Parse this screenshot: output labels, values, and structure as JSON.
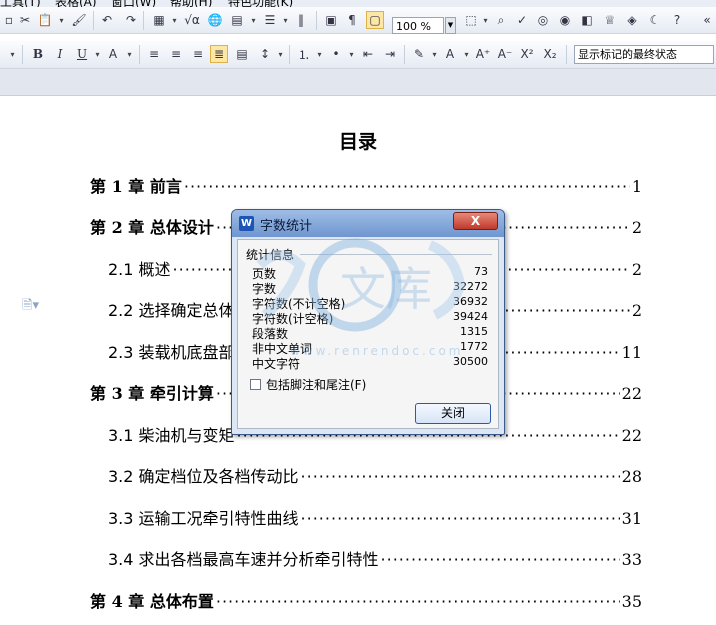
{
  "menubar": {
    "items": [
      "工具(T)",
      "表格(A)",
      "窗口(W)",
      "帮助(H)",
      "特色功能(K)"
    ]
  },
  "toolbar": {
    "zoom_value": "100 %",
    "track_changes_view": "显示标记的最终状态"
  },
  "document": {
    "title": "目录",
    "toc": [
      {
        "label": "第 1 章  前言",
        "page": "1",
        "level": 1
      },
      {
        "label": "第 2 章  总体设计",
        "page": "2",
        "level": 1
      },
      {
        "label": "2.1  概述",
        "page": "2",
        "level": 2
      },
      {
        "label": "2.2  选择确定总体",
        "page": "2",
        "level": 2
      },
      {
        "label": "2.3  装载机底盘部",
        "page": "11",
        "level": 2
      },
      {
        "label": "第 3 章  牵引计算",
        "page": "22",
        "level": 1
      },
      {
        "label": "3.1  柴油机与变矩",
        "page": "22",
        "level": 2
      },
      {
        "label": "3.2  确定档位及各档传动比",
        "page": "28",
        "level": 2
      },
      {
        "label": "3.3  运输工况牵引特性曲线",
        "page": "31",
        "level": 2
      },
      {
        "label": "3.4  求出各档最高车速并分析牵引特性",
        "page": "33",
        "level": 2
      },
      {
        "label": "第 4 章  总体布置",
        "page": "35",
        "level": 1
      }
    ]
  },
  "dialog": {
    "title": "字数统计",
    "close_x": "X",
    "group_label": "统计信息",
    "stats": [
      {
        "label": "页数",
        "value": "73"
      },
      {
        "label": "字数",
        "value": "32272"
      },
      {
        "label": "字符数(不计空格)",
        "value": "36932"
      },
      {
        "label": "字符数(计空格)",
        "value": "39424"
      },
      {
        "label": "段落数",
        "value": "1315"
      },
      {
        "label": "非中文单词",
        "value": "1772"
      },
      {
        "label": "中文字符",
        "value": "30500"
      }
    ],
    "include_footnotes_label": "包括脚注和尾注(F)",
    "include_footnotes_checked": false,
    "close_button": "关闭"
  },
  "watermark": {
    "text": "文库",
    "url": "www.renrendoc.com"
  }
}
